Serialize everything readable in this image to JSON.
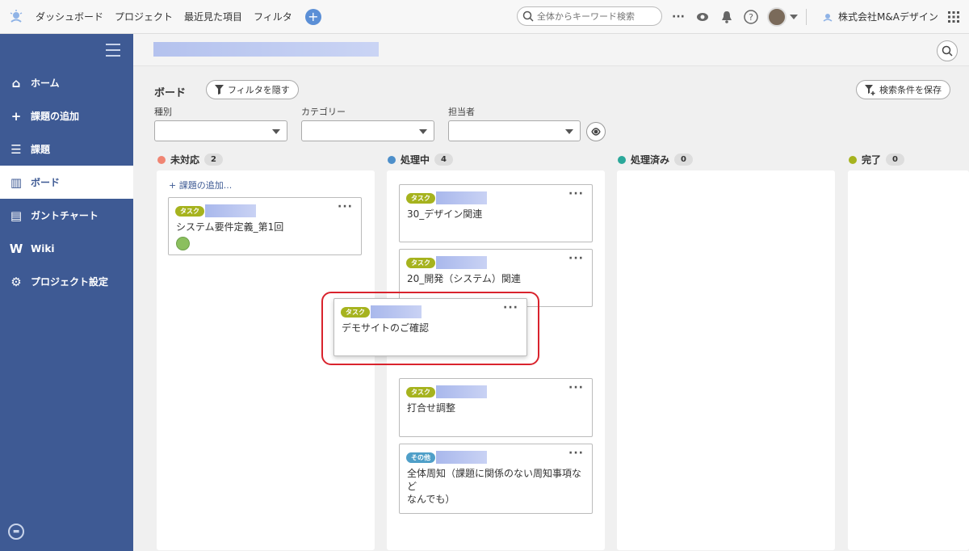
{
  "topbar": {
    "nav": [
      "ダッシュボード",
      "プロジェクト",
      "最近見た項目",
      "フィルタ"
    ],
    "add_label": "+",
    "search_placeholder": "全体からキーワード検索",
    "more_label": "···",
    "org_name": "株式会社M&Aデザイン"
  },
  "sidebar": {
    "items": [
      {
        "label": "ホーム",
        "icon": "home-icon",
        "glyph": "⌂"
      },
      {
        "label": "課題の追加",
        "icon": "plus-icon",
        "glyph": "+"
      },
      {
        "label": "課題",
        "icon": "list-icon",
        "glyph": "☰"
      },
      {
        "label": "ボード",
        "icon": "board-icon",
        "glyph": "▥",
        "active": true
      },
      {
        "label": "ガントチャート",
        "icon": "gantt-icon",
        "glyph": "▤"
      },
      {
        "label": "Wiki",
        "icon": "wiki-icon",
        "glyph": "W"
      },
      {
        "label": "プロジェクト設定",
        "icon": "gear-icon",
        "glyph": "⚙"
      }
    ]
  },
  "board": {
    "title": "ボード",
    "hide_filter_label": "フィルタを隠す",
    "save_search_label": "検索条件を保存",
    "filters": {
      "type_label": "種別",
      "category_label": "カテゴリー",
      "assignee_label": "担当者"
    },
    "columns": [
      {
        "name": "未対応",
        "count": "2",
        "color": "#f08573"
      },
      {
        "name": "処理中",
        "count": "4",
        "color": "#4d8fca"
      },
      {
        "name": "処理済み",
        "count": "0",
        "color": "#2ba89a"
      },
      {
        "name": "完了",
        "count": "0",
        "color": "#a6b31e"
      }
    ],
    "add_issue_label": "+ 課題の追加...",
    "cards": {
      "c1": {
        "tag": "タスク",
        "title": "システム要件定義_第1回"
      },
      "c2": {
        "tag": "タスク",
        "title": "30_デザイン関連"
      },
      "c3": {
        "tag": "タスク",
        "title": "20_開発（システム）関連"
      },
      "c4": {
        "tag": "タスク",
        "title": "デモサイトのご確認"
      },
      "c5": {
        "tag": "タスク",
        "title": "打合せ調整"
      },
      "c6": {
        "tag": "その他",
        "title_line1": "全体周知（課題に関係のない周知事項など",
        "title_line2": "なんでも）"
      }
    },
    "menu_label": "···"
  }
}
